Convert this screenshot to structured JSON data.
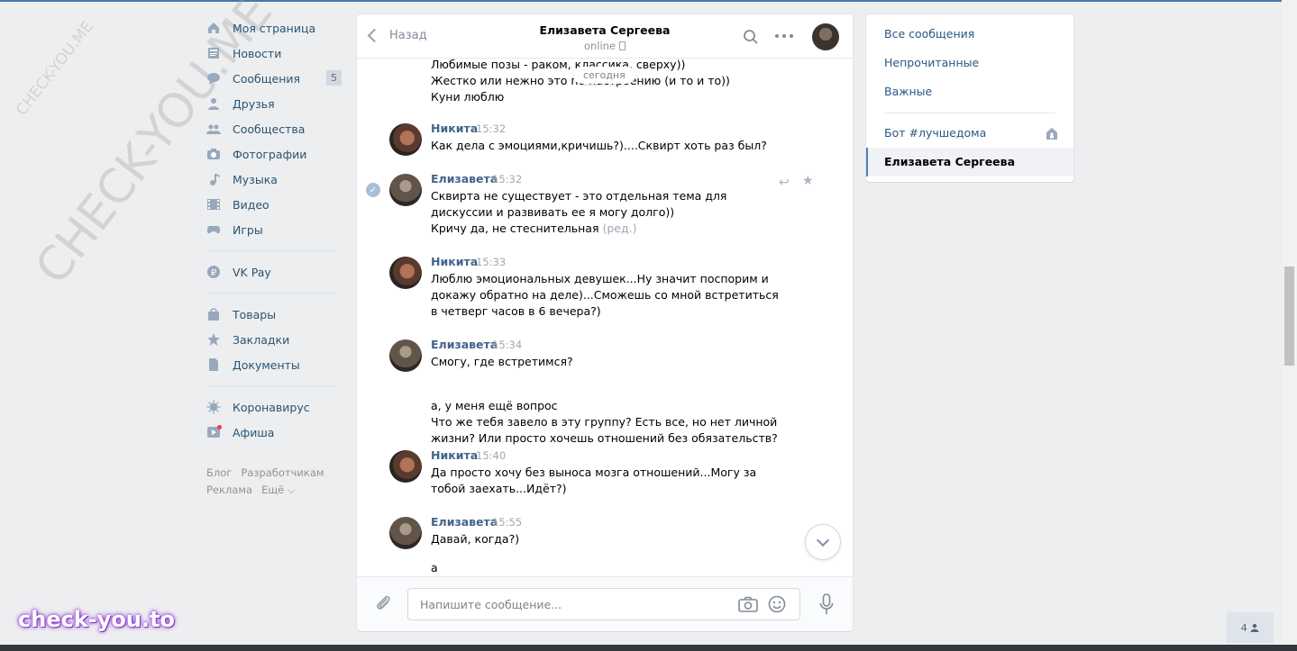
{
  "watermark": {
    "small": "CHECK-YOU.ME",
    "large": "CHECK-YOU.ME",
    "brand": "check-you.to"
  },
  "nav": {
    "items": [
      {
        "label": "Моя страница"
      },
      {
        "label": "Новости"
      },
      {
        "label": "Сообщения",
        "badge": "5"
      },
      {
        "label": "Друзья"
      },
      {
        "label": "Сообщества"
      },
      {
        "label": "Фотографии"
      },
      {
        "label": "Музыка"
      },
      {
        "label": "Видео"
      },
      {
        "label": "Игры"
      },
      {
        "label": "VK Pay"
      },
      {
        "label": "Товары"
      },
      {
        "label": "Закладки"
      },
      {
        "label": "Документы"
      },
      {
        "label": "Коронавирус"
      },
      {
        "label": "Афиша"
      }
    ],
    "footer": {
      "blog": "Блог",
      "dev": "Разработчикам",
      "ads": "Реклама",
      "more": "Ещё ⌵"
    }
  },
  "chat": {
    "back": "Назад",
    "title": "Елизавета Сергеева",
    "status": "online",
    "date_chip": "сегодня",
    "messages": [
      {
        "text": "Любимые позы - раком, классика, сверху))\nЖестко или нежно это по настроению (и то и то))\nКуни люблю"
      },
      {
        "author": "Никита",
        "time": "15:32",
        "text": "Как дела с эмоциями,кричишь?)....Сквирт хоть раз был?"
      },
      {
        "author": "Елизавета",
        "time": "15:32",
        "text": "Сквирта не существует - это отдельная тема для дискуссии и развивать ее я могу долго))\nКричу да, не стеснительная",
        "edited": "(ред.)"
      },
      {
        "author": "Никита",
        "time": "15:33",
        "text": "Люблю эмоциональных девушек...Ну значит поспорим и докажу обратно на деле)...Сможешь со мной встретиться в четверг часов в 6 вечера?)"
      },
      {
        "author": "Елизавета",
        "time": "15:34",
        "text": "Смогу, где встретимся?"
      },
      {
        "text": "а, у меня ещё вопрос\nЧто же тебя завело в эту группу? Есть все, но нет личной жизни? Или просто хочешь отношений без обязательств?"
      },
      {
        "author": "Никита",
        "time": "15:40",
        "text": "Да просто хочу без выноса мозга отношений...Могу за тобой заехать...Идёт?)"
      },
      {
        "author": "Елизавета",
        "time": "15:55",
        "text": "Давай, когда?)"
      },
      {
        "text": "а"
      }
    ],
    "composer_placeholder": "Напишите сообщение..."
  },
  "right_menu": {
    "all": "Все сообщения",
    "unread": "Непрочитанные",
    "important": "Важные",
    "bot": "Бот #лучшедома",
    "current": "Елизавета Сергеева"
  },
  "online_widget": "4"
}
